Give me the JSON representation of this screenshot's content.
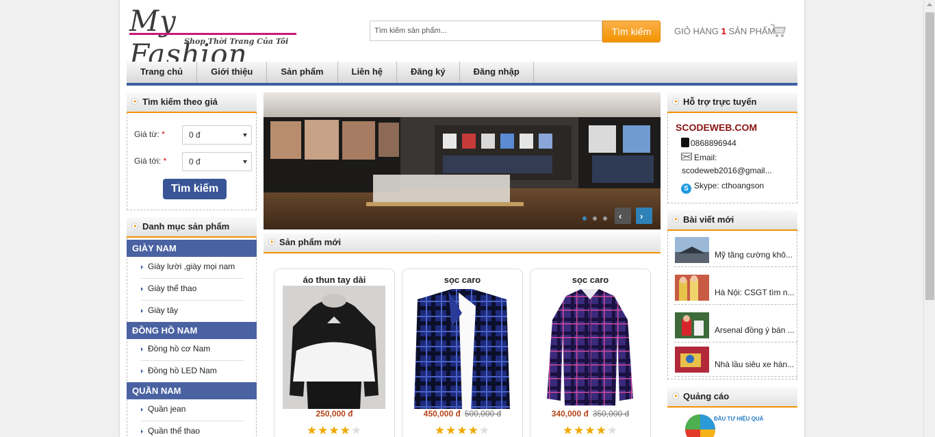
{
  "logo": {
    "script": "My Fashion",
    "tagline": "Shop Thời Trang Của Tôi"
  },
  "search": {
    "placeholder": "Tìm kiếm sản phẩm...",
    "button": "Tìm kiếm"
  },
  "cart": {
    "prefix": "GIỎ HÀNG ",
    "count": "1",
    "suffix": " SẢN PHẨM",
    "icon": "cart-icon"
  },
  "nav": [
    "Trang chủ",
    "Giới thiệu",
    "Sản phẩm",
    "Liên hệ",
    "Đăng ký",
    "Đăng nhập"
  ],
  "price_search": {
    "title": "Tìm kiếm theo giá",
    "from_label": "Giá từ:",
    "to_label": "Giá tới:",
    "required": "*",
    "from_value": "0 đ",
    "to_value": "0 đ",
    "button": "Tìm kiếm"
  },
  "categories": {
    "title": "Danh mục sản phẩm",
    "groups": [
      {
        "name": "GIÀY NAM",
        "items": [
          "Giày lười ,giày mọi nam",
          "Giày thể thao",
          "Giày tây"
        ]
      },
      {
        "name": "ĐỒNG HỒ NAM",
        "items": [
          "Đồng hồ cơ Nam",
          "Đồng hồ LED Nam"
        ]
      },
      {
        "name": "QUẦN NAM",
        "items": [
          "Quần jean",
          "Quần thể thao"
        ]
      }
    ]
  },
  "new_products": {
    "title": "Sản phẩm mới",
    "items": [
      {
        "name": "áo thun tay dài",
        "price": "250,000 đ",
        "old_price": "",
        "rating": 4
      },
      {
        "name": "sọc caro",
        "price": "450,000 đ",
        "old_price": "500,000 đ",
        "rating": 4
      },
      {
        "name": "sọc caro",
        "price": "340,000 đ",
        "old_price": "350,000 đ",
        "rating": 4
      }
    ]
  },
  "support": {
    "title": "Hỗ trợ trực tuyến",
    "site": "SCODEWEB.COM",
    "phone": "0868896944",
    "email_label": "Email:",
    "email": "scodeweb2016@gmail...",
    "skype": "Skype: cthoangson"
  },
  "news": {
    "title": "Bài viết mới",
    "items": [
      "Mỹ tăng cường khô...",
      "Hà Nội: CSGT tìm n...",
      "Arsenal đồng ý bán ...",
      "Nhà lầu siêu xe hàn..."
    ]
  },
  "ads": {
    "title": "Quảng cáo",
    "text": "ĐẦU TƯ HIỆU QUẢ"
  },
  "colors": {
    "accent": "#f39200",
    "nav_border": "#3e5ea0",
    "category_header": "#4a62a2",
    "price": "#b5421a"
  }
}
